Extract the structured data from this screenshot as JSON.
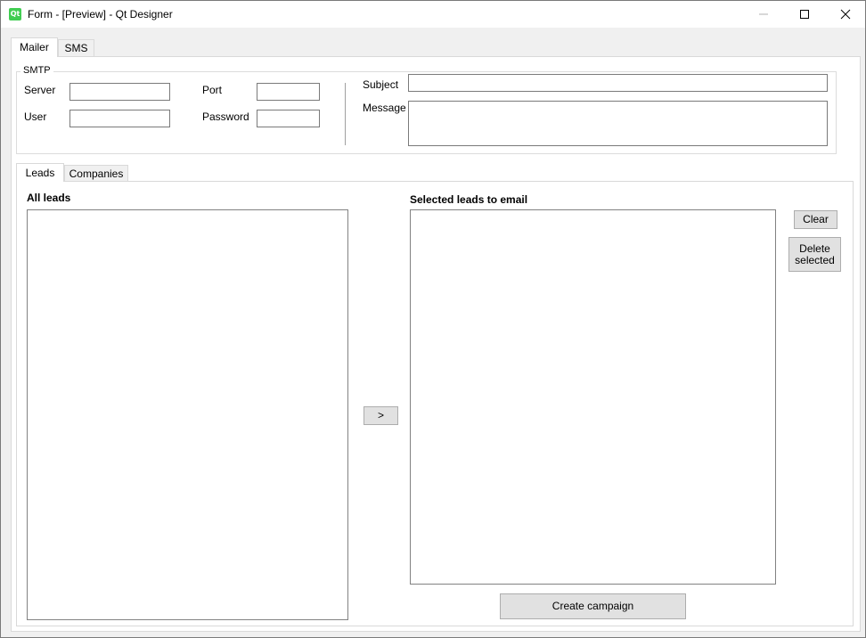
{
  "window": {
    "title": "Form - [Preview] - Qt Designer",
    "icon": "qt-logo-icon",
    "icon_text": "Qt"
  },
  "outer_tabs": [
    {
      "label": "Mailer",
      "active": true
    },
    {
      "label": "SMS",
      "active": false
    }
  ],
  "smtp": {
    "group_title": "SMTP",
    "server_label": "Server",
    "server_value": "",
    "port_label": "Port",
    "port_value": "",
    "user_label": "User",
    "user_value": "",
    "password_label": "Password",
    "password_value": ""
  },
  "email": {
    "subject_label": "Subject",
    "subject_value": "",
    "message_label": "Message",
    "message_value": ""
  },
  "inner_tabs": [
    {
      "label": "Leads",
      "active": true
    },
    {
      "label": "Companies",
      "active": false
    }
  ],
  "leads": {
    "all_title": "All leads",
    "all_items": [],
    "selected_title": "Selected leads to email",
    "selected_items": [],
    "move_button": ">",
    "clear_button": "Clear",
    "delete_button_line1": "Delete",
    "delete_button_line2": "selected",
    "create_button": "Create campaign"
  },
  "colors": {
    "window_bg": "#f0f0f0",
    "pane_bg": "#ffffff",
    "button_bg": "#e1e1e1",
    "qt_green": "#41cd52"
  }
}
